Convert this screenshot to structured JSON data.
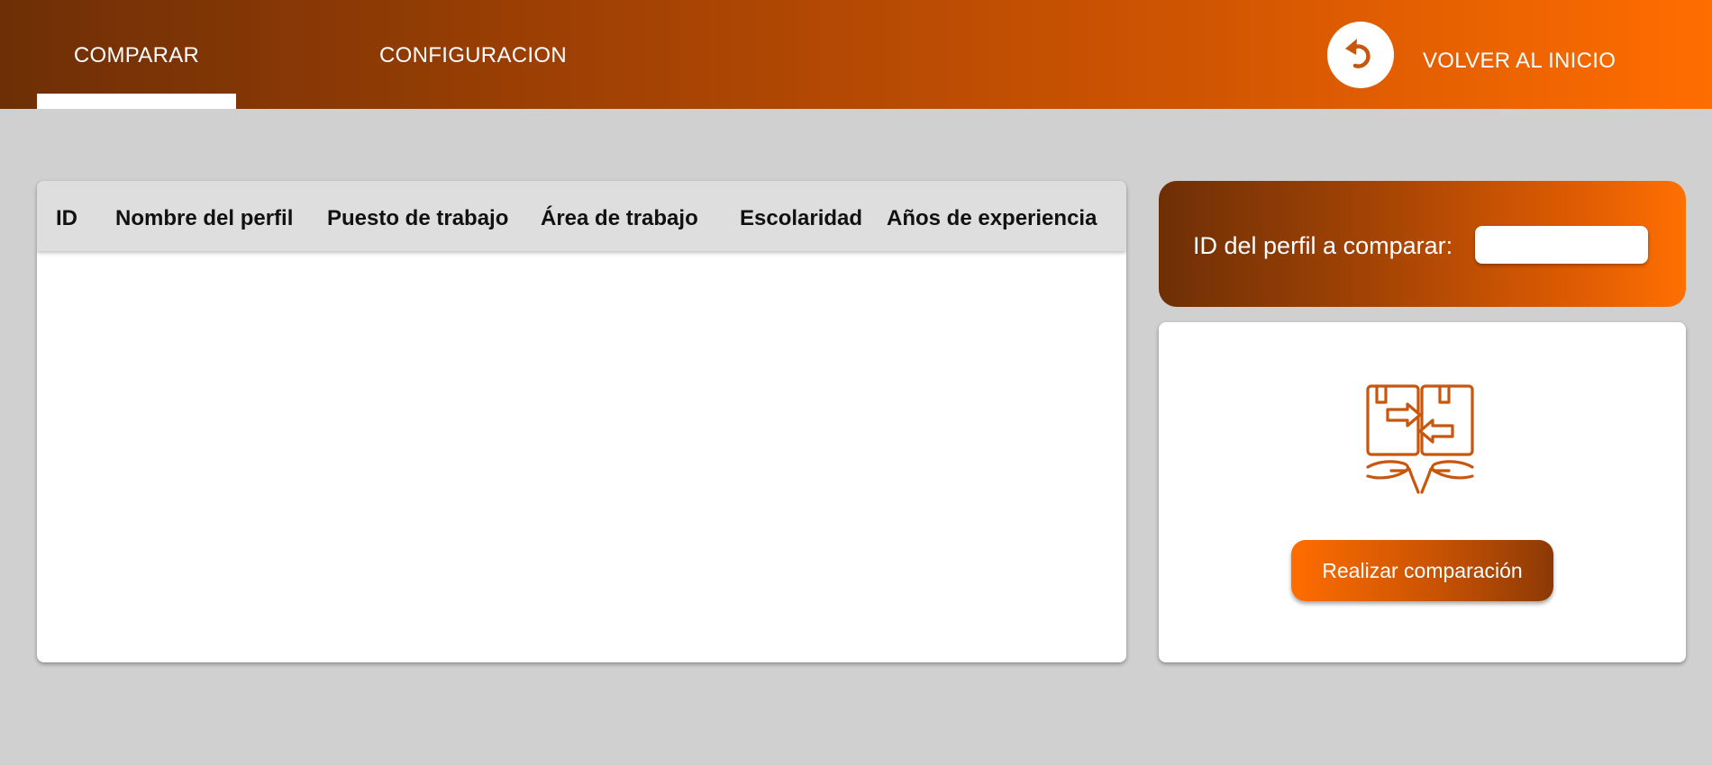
{
  "nav": {
    "tabs": [
      {
        "label": "COMPARAR",
        "active": true
      },
      {
        "label": "CONFIGURACION",
        "active": false
      }
    ],
    "back_icon": "undo-arrow-icon",
    "back_label": "VOLVER AL INICIO"
  },
  "table": {
    "columns": [
      "ID",
      "Nombre del perfil",
      "Puesto de trabajo",
      "Área de trabajo",
      "Escolaridad",
      "Años de experiencia"
    ],
    "rows": []
  },
  "compare_panel": {
    "id_label": "ID del perfil a comparar:",
    "id_value": "",
    "icon": "exchange-boxes-hands-icon",
    "button_label": "Realizar comparación"
  },
  "colors": {
    "brand_dark": "#6e2f06",
    "brand_orange": "#ff6d00",
    "icon_orange": "#c8560c",
    "background": "#d0d0d0"
  }
}
